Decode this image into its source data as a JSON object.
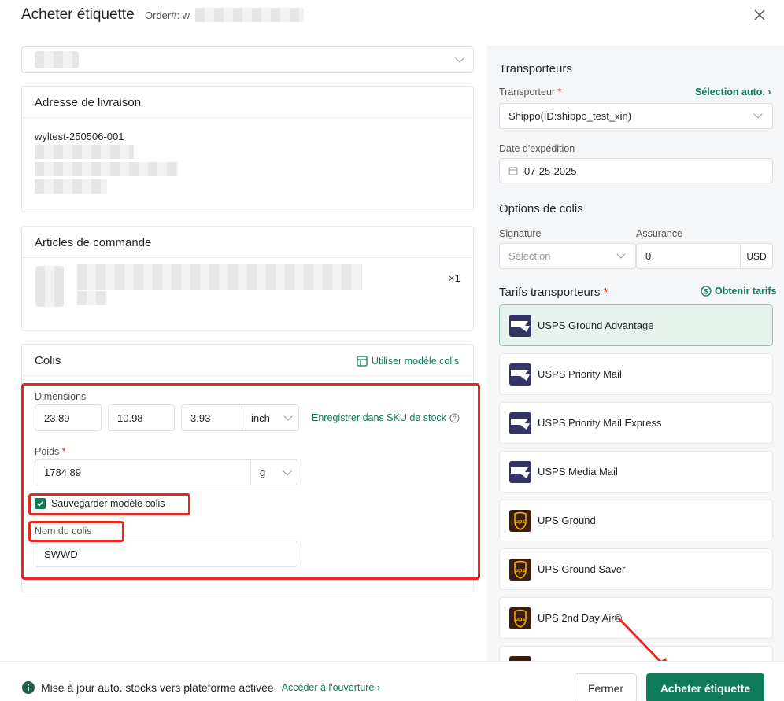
{
  "header": {
    "title": "Acheter étiquette",
    "order_label": "Order#: w"
  },
  "shipping_address": {
    "title": "Adresse de livraison",
    "line1": "wyltest-250506-001"
  },
  "order_items": {
    "title": "Articles de commande",
    "quantity": "×1"
  },
  "package": {
    "title": "Colis",
    "use_template": "Utiliser modèle colis",
    "dimensions_label": "Dimensions",
    "length": "23.89",
    "width": "10.98",
    "height": "3.93",
    "dim_unit": "inch",
    "save_sku_link": "Enregistrer dans SKU de stock",
    "weight_label": "Poids",
    "weight": "1784.89",
    "weight_unit": "g",
    "save_template_label": "Sauvegarder modèle colis",
    "name_label": "Nom du colis",
    "name_value": "SWWD"
  },
  "carriers": {
    "title": "Transporteurs",
    "carrier_label": "Transporteur",
    "auto_select": "Sélection auto.",
    "carrier_value": "Shippo(ID:shippo_test_xin)",
    "ship_date_label": "Date d'expédition",
    "ship_date": "07-25-2025"
  },
  "package_options": {
    "title": "Options de colis",
    "signature_label": "Signature",
    "signature_placeholder": "Sélection",
    "insurance_label": "Assurance",
    "insurance_value": "0",
    "currency": "USD"
  },
  "rates": {
    "title": "Tarifs transporteurs",
    "get_rates": "Obtenir tarifs",
    "items": [
      {
        "name": "USPS Ground Advantage",
        "logo": "usps-logo-icon",
        "selected": true
      },
      {
        "name": "USPS Priority Mail",
        "logo": "usps-logo-icon",
        "selected": false
      },
      {
        "name": "USPS Priority Mail Express",
        "logo": "usps-logo-icon",
        "selected": false
      },
      {
        "name": "USPS Media Mail",
        "logo": "usps-logo-icon",
        "selected": false
      },
      {
        "name": "UPS Ground",
        "logo": "ups-logo-icon",
        "selected": false
      },
      {
        "name": "UPS Ground Saver",
        "logo": "ups-logo-icon",
        "selected": false
      },
      {
        "name": "UPS 2nd Day Air®",
        "logo": "ups-logo-icon",
        "selected": false
      }
    ]
  },
  "footer": {
    "notice": "Mise à jour auto. stocks vers plateforme activée",
    "notice_link": "Accéder à l'ouverture",
    "close_button": "Fermer",
    "buy_button": "Acheter étiquette"
  },
  "colors": {
    "accent": "#0e7a5a",
    "annotation_red": "#e8271f",
    "usps_blue": "#333366",
    "ups_brown": "#3b1d0f"
  }
}
